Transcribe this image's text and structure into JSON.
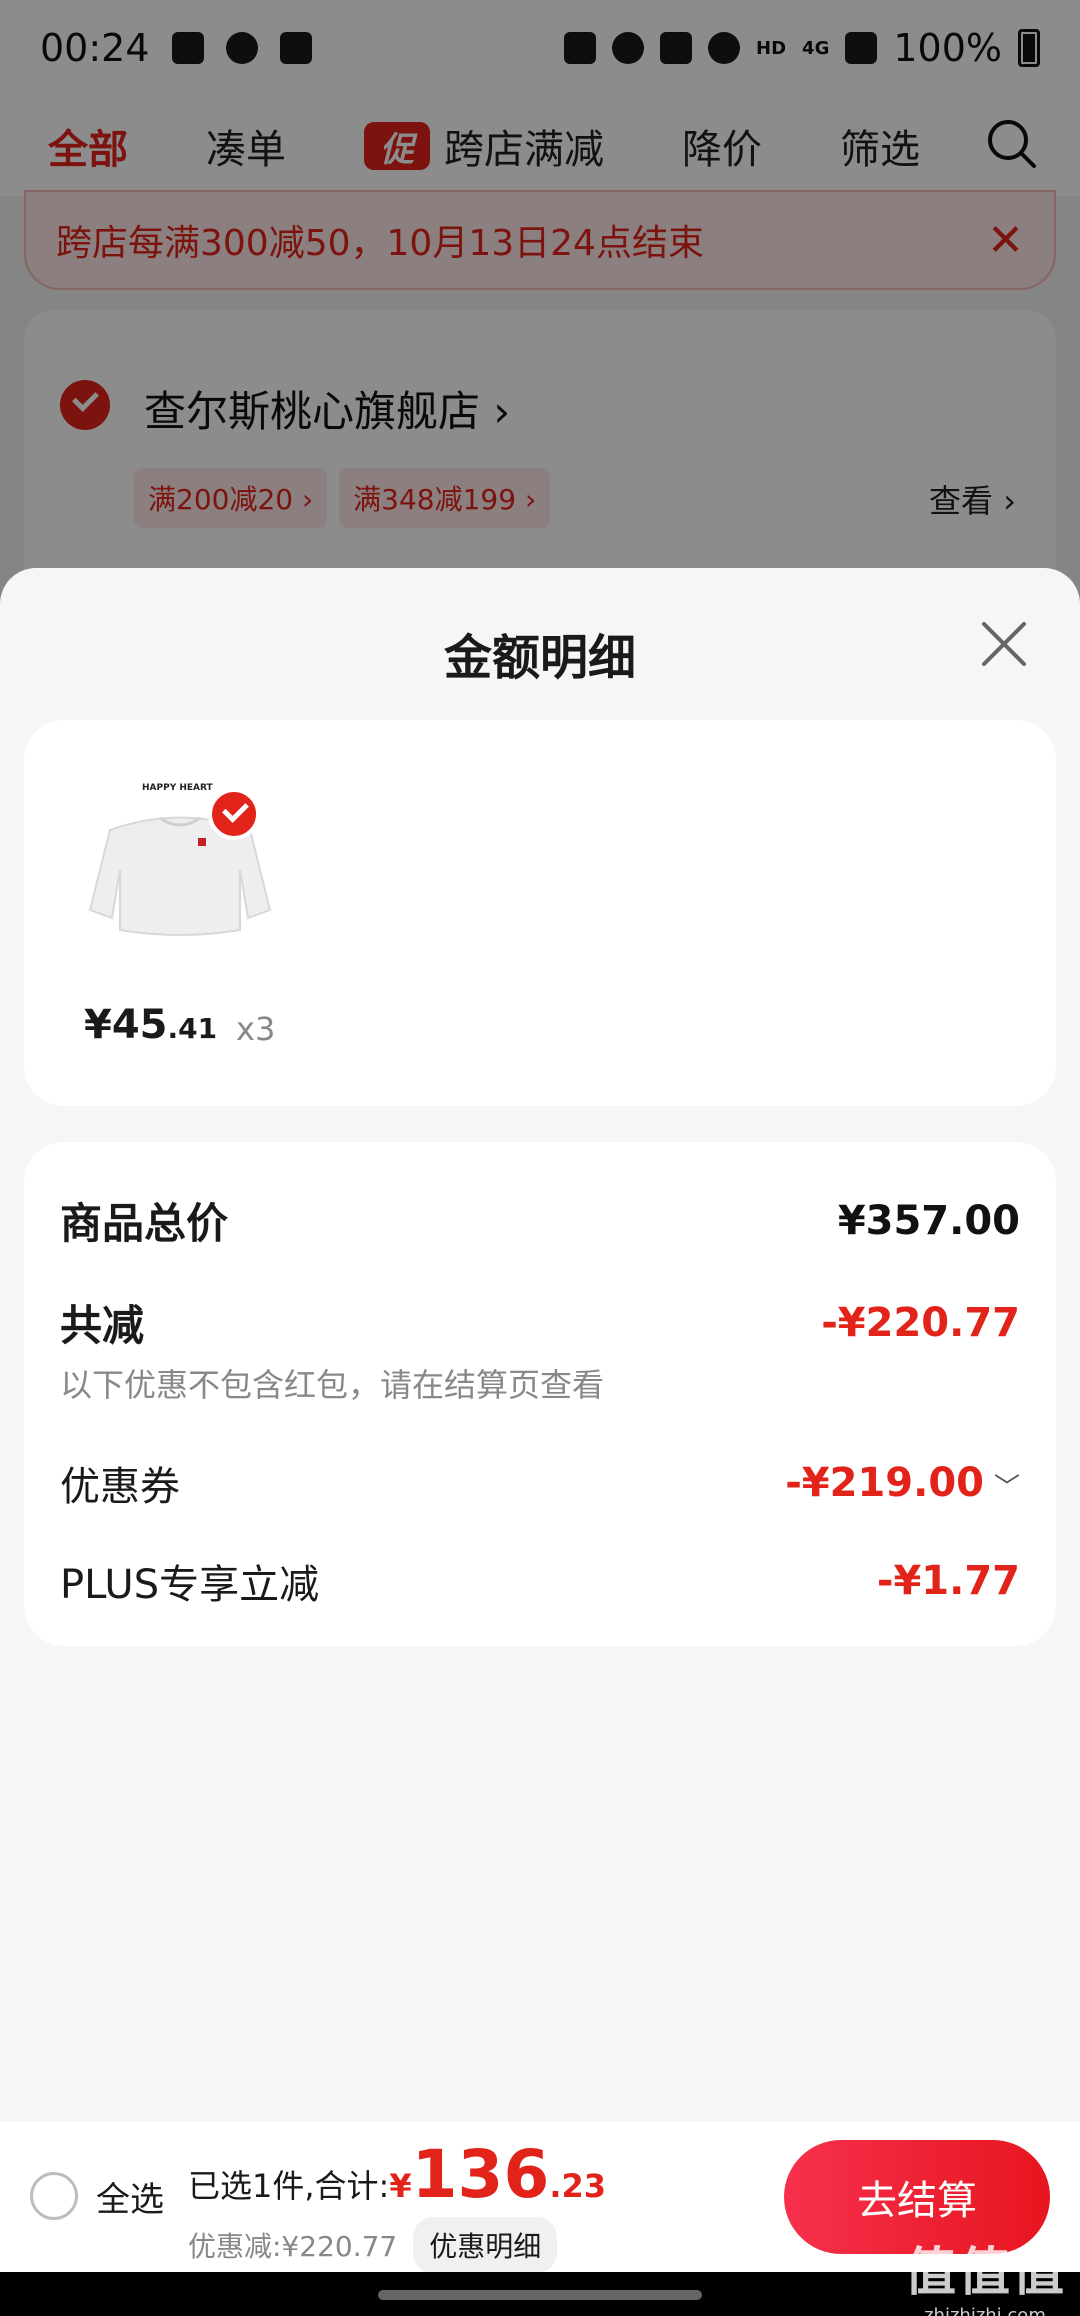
{
  "status_bar": {
    "time": "00:24",
    "network_hd": "HD",
    "network_type": "4G",
    "battery": "100%"
  },
  "tabs": [
    {
      "label": "全部"
    },
    {
      "label": "凑单"
    },
    {
      "label": "跨店满减",
      "badge": "促"
    },
    {
      "label": "降价"
    },
    {
      "label": "筛选"
    }
  ],
  "banner": {
    "text": "跨店每满300减50，10月13日24点结束"
  },
  "store": {
    "name": "查尔斯桃心旗舰店 ›",
    "tags": [
      "满200减20 ›",
      "满348减199 ›"
    ],
    "view": "查看 ›"
  },
  "sheet": {
    "title": "金额明细",
    "product": {
      "currency": "¥",
      "price_int": "45",
      "price_dec": ".41",
      "qty": "x3",
      "image_text": "HAPPY HEART"
    },
    "rows": {
      "subtotal_label": "商品总价",
      "subtotal_value": "¥357.00",
      "total_discount_label": "共减",
      "total_discount_value": "-¥220.77",
      "note": "以下优惠不包含红包，请在结算页查看",
      "coupon_label": "优惠券",
      "coupon_value": "-¥219.00",
      "plus_label": "PLUS专享立减",
      "plus_value": "-¥1.77"
    }
  },
  "bottom_bar": {
    "select_all": "全选",
    "selected_text": "已选1件,合计:",
    "total_currency": "¥",
    "total_int": "136",
    "total_dec": ".23",
    "discount_text": "优惠减:¥220.77",
    "detail_button": "优惠明细",
    "checkout_button": "去结算"
  },
  "watermark": {
    "logo": "值值值",
    "site": "zhizhizhi.com"
  },
  "colors": {
    "accent": "#e2231a",
    "sheet_bg": "#f6f6f6"
  }
}
